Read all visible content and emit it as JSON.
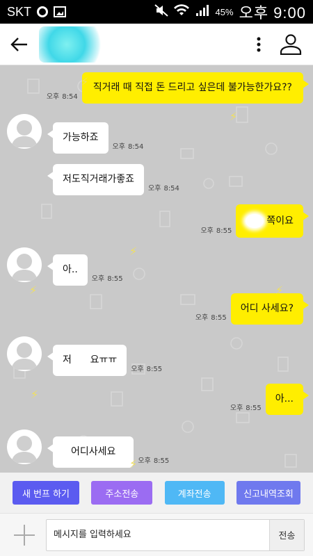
{
  "status": {
    "carrier": "SKT",
    "battery": "45%",
    "time": "오후 9:00"
  },
  "header": {
    "back_icon": "arrow-left-icon",
    "more_icon": "more-vertical-icon",
    "profile_icon": "person-icon"
  },
  "messages": [
    {
      "dir": "out",
      "text": "직거래 때 직접 돈 드리고 싶은데 불가능한가요??",
      "time": "8:54",
      "ampm": "오후"
    },
    {
      "dir": "in",
      "text": "가능하죠",
      "time": "8:54",
      "ampm": "오후"
    },
    {
      "dir": "in",
      "text": "저도직거래가좋죠",
      "time": "8:54",
      "ampm": "오후"
    },
    {
      "dir": "out",
      "text": "쪽이요",
      "time": "8:55",
      "ampm": "오후"
    },
    {
      "dir": "in",
      "text": "아..",
      "time": "8:55",
      "ampm": "오후"
    },
    {
      "dir": "out",
      "text": "어디 사세요?",
      "time": "8:55",
      "ampm": "오후"
    },
    {
      "dir": "in",
      "text": "저      요ㅠㅠ",
      "time": "8:55",
      "ampm": "오후"
    },
    {
      "dir": "out",
      "text": "아...",
      "time": "8:55",
      "ampm": "오후"
    },
    {
      "dir": "in",
      "text": "어디사세요",
      "time": "8:55",
      "ampm": "오후"
    }
  ],
  "quick_actions": [
    {
      "label": "새 번프 하기",
      "color": "#5b5bf0"
    },
    {
      "label": "주소전송",
      "color": "#9b6cf2"
    },
    {
      "label": "계좌전송",
      "color": "#4fb8f5"
    },
    {
      "label": "신고내역조회",
      "color": "#6f79ee"
    }
  ],
  "composer": {
    "placeholder": "메시지를 입력하세요",
    "send_label": "전송",
    "plus_icon": "plus-icon"
  },
  "colors": {
    "out_bubble": "#ffee00",
    "in_bubble": "#ffffff",
    "chat_bg": "#c9c9c9"
  }
}
